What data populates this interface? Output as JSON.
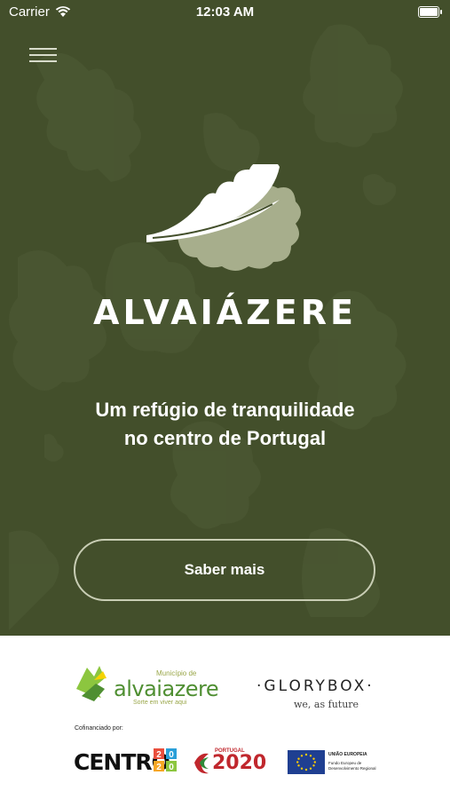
{
  "status_bar": {
    "carrier": "Carrier",
    "time": "12:03 AM"
  },
  "hero": {
    "brand_name": "ALVAIÁZERE",
    "tagline_line1": "Um refúgio de tranquilidade",
    "tagline_line2": "no centro de Portugal",
    "cta_label": "Saber mais"
  },
  "footer": {
    "alvaiazere_logo": {
      "small": "Município de",
      "word": "alvaiazere",
      "slogan": "Sorte em viver aqui"
    },
    "glorybox": {
      "name": "·GLORYBOX·",
      "slogan": "we, as future"
    },
    "cofinanced_label": "Cofinanciado por:",
    "centro": {
      "text": "CENTRO",
      "digits": "2020"
    },
    "portugal2020": {
      "small": "PORTUGAL",
      "big": "2020"
    },
    "eu": {
      "title": "UNIÃO EUROPEIA",
      "sub": "Fundo Europeu de Desenvolvimento Regional"
    }
  },
  "colors": {
    "hero_bg": "#434f2b",
    "leaf_light": "#a7ae8c",
    "button_border": "#c8cdb4"
  },
  "icons": {
    "menu": "hamburger-icon",
    "wifi": "wifi-icon",
    "battery": "battery-icon"
  }
}
